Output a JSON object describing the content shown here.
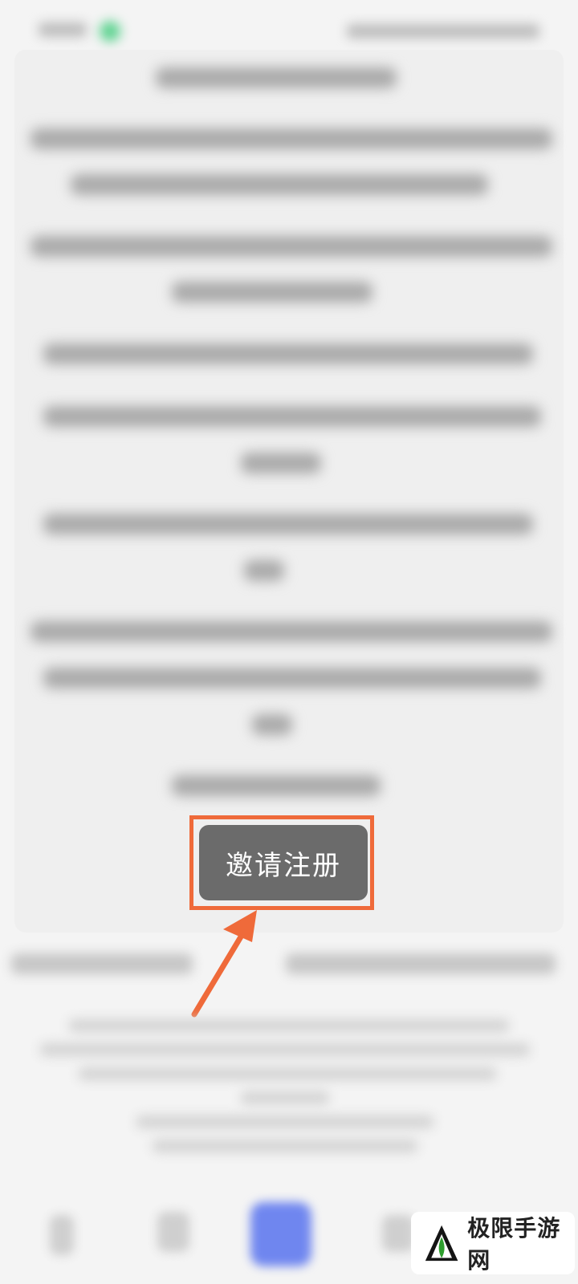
{
  "invite": {
    "button_label": "邀请注册"
  },
  "watermark": {
    "text": "极限手游网"
  },
  "colors": {
    "highlight": "#ef6a3a",
    "button": "#6b6b6b",
    "nav_main": "#6f86ef",
    "status_dot": "#5fd391"
  },
  "icons": [
    "status-dot-icon",
    "arrow-annotation-icon",
    "back-icon",
    "pen-icon",
    "main-action-icon",
    "profile-icon",
    "watermark-logo-icon"
  ]
}
